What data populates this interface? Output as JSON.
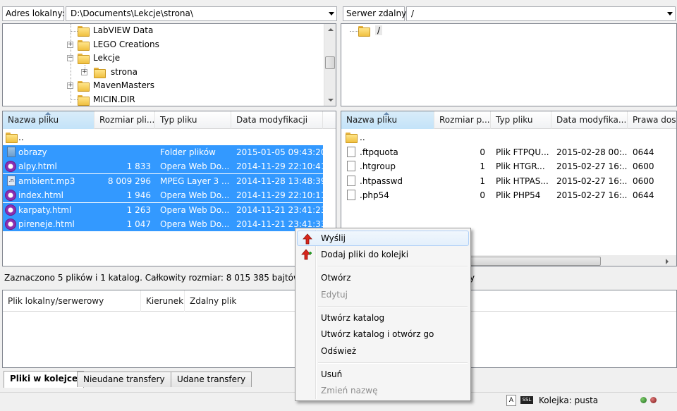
{
  "local": {
    "address_label": "Adres lokalny:",
    "address_value": "D:\\Documents\\Lekcje\\strona\\",
    "tree": [
      {
        "label": "LabVIEW Data",
        "expander": ""
      },
      {
        "label": "LEGO Creations",
        "expander": "+"
      },
      {
        "label": "Lekcje",
        "expander": "−"
      },
      {
        "label": "strona",
        "expander": "+"
      },
      {
        "label": "MavenMasters",
        "expander": "+"
      },
      {
        "label": "MICIN.DIR",
        "expander": ""
      }
    ],
    "columns": [
      "Nazwa pliku",
      "Rozmiar pli...",
      "Typ pliku",
      "Data modyfikacji"
    ],
    "files": [
      {
        "name": "..",
        "size": "",
        "type": "",
        "date": "",
        "icon": "folder-icon",
        "selected": false
      },
      {
        "name": "obrazy",
        "size": "",
        "type": "Folder plików",
        "date": "2015-01-05 09:43:20",
        "icon": "folder-icon",
        "selected": true
      },
      {
        "name": "alpy.html",
        "size": "1 833",
        "type": "Opera Web Do...",
        "date": "2014-11-29 22:10:41",
        "icon": "opera-icon",
        "selected": true
      },
      {
        "name": "ambient.mp3",
        "size": "8 009 296",
        "type": "MPEG Layer 3 ...",
        "date": "2014-11-28 13:48:39",
        "icon": "mp3-icon",
        "selected": true
      },
      {
        "name": "index.html",
        "size": "1 946",
        "type": "Opera Web Do...",
        "date": "2014-11-29 22:10:11",
        "icon": "opera-icon",
        "selected": true
      },
      {
        "name": "karpaty.html",
        "size": "1 263",
        "type": "Opera Web Do...",
        "date": "2014-11-21 23:41:23",
        "icon": "opera-icon",
        "selected": true
      },
      {
        "name": "pireneje.html",
        "size": "1 047",
        "type": "Opera Web Do...",
        "date": "2014-11-21 23:41:33",
        "icon": "opera-icon",
        "selected": true
      }
    ],
    "status": "Zaznaczono 5 plików i 1 katalog. Całkowity rozmiar: 8 015 385 bajtów"
  },
  "remote": {
    "address_label": "Serwer zdalny:",
    "address_value": "/",
    "tree_root": "/",
    "columns": [
      "Nazwa pliku",
      "Rozmiar p...",
      "Typ pliku",
      "Data modyfika...",
      "Prawa dos"
    ],
    "files": [
      {
        "name": "..",
        "size": "",
        "type": "",
        "date": "",
        "perm": ""
      },
      {
        "name": ".ftpquota",
        "size": "0",
        "type": "Plik FTPQU...",
        "date": "2015-02-28 00:...",
        "perm": "0644"
      },
      {
        "name": ".htgroup",
        "size": "1",
        "type": "Plik HTGR...",
        "date": "2015-02-27 16:...",
        "perm": "0600"
      },
      {
        "name": ".htpasswd",
        "size": "1",
        "type": "Plik HTPAS...",
        "date": "2015-02-27 16:...",
        "perm": "0600"
      },
      {
        "name": ".php54",
        "size": "0",
        "type": "Plik PHP54",
        "date": "2015-02-27 16:...",
        "perm": "0644"
      }
    ],
    "status_suffix": "y"
  },
  "queue": {
    "columns": [
      "Plik lokalny/serwerowy",
      "Kierunek",
      "Zdalny plik"
    ],
    "tabs": [
      "Pliki w kolejce",
      "Nieudane transfery",
      "Udane transfery"
    ],
    "status": "Kolejka: pusta"
  },
  "context_menu": [
    {
      "label": "Wyślij",
      "icon": "upload-arrow-icon",
      "disabled": false,
      "highlighted": true
    },
    {
      "label": "Dodaj pliki do kolejki",
      "icon": "add-to-queue-icon",
      "disabled": false,
      "highlighted": false
    },
    {
      "label": "Otwórz",
      "disabled": false
    },
    {
      "label": "Edytuj",
      "disabled": true
    },
    {
      "label": "Utwórz katalog",
      "disabled": false
    },
    {
      "label": "Utwórz katalog i otwórz go",
      "disabled": false
    },
    {
      "label": "Odśwież",
      "disabled": false
    },
    {
      "label": "Usuń",
      "disabled": false
    },
    {
      "label": "Zmień nazwę",
      "disabled": true
    }
  ],
  "colors": {
    "selection": "#3399ff",
    "panel_bg": "#f0f0f0"
  }
}
